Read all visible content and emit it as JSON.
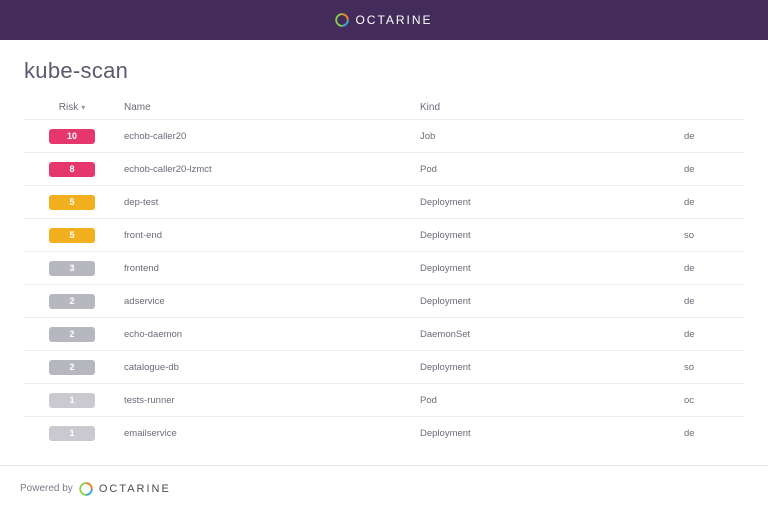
{
  "brand_name": "OCTARINE",
  "page_title": "kube-scan",
  "colors": {
    "risk_high": "#e6366e",
    "risk_med": "#f2b01e",
    "risk_low": "#b7b7c0",
    "risk_lowest": "#c9c9cf"
  },
  "columns": {
    "risk": "Risk",
    "name": "Name",
    "kind": "Kind",
    "namespace": ""
  },
  "rows": [
    {
      "risk": "10",
      "risk_level": "high",
      "name": "echob-caller20",
      "kind": "Job",
      "ns": "de"
    },
    {
      "risk": "8",
      "risk_level": "high",
      "name": "echob-caller20-lzmct",
      "kind": "Pod",
      "ns": "de"
    },
    {
      "risk": "5",
      "risk_level": "med",
      "name": "dep-test",
      "kind": "Deployment",
      "ns": "de"
    },
    {
      "risk": "5",
      "risk_level": "med",
      "name": "front-end",
      "kind": "Deployment",
      "ns": "so"
    },
    {
      "risk": "3",
      "risk_level": "low",
      "name": "frontend",
      "kind": "Deployment",
      "ns": "de"
    },
    {
      "risk": "2",
      "risk_level": "low",
      "name": "adservice",
      "kind": "Deployment",
      "ns": "de"
    },
    {
      "risk": "2",
      "risk_level": "low",
      "name": "echo-daemon",
      "kind": "DaemonSet",
      "ns": "de"
    },
    {
      "risk": "2",
      "risk_level": "low",
      "name": "catalogue-db",
      "kind": "Deployment",
      "ns": "so"
    },
    {
      "risk": "1",
      "risk_level": "lowest",
      "name": "tests-runner",
      "kind": "Pod",
      "ns": "oc"
    },
    {
      "risk": "1",
      "risk_level": "lowest",
      "name": "emailservice",
      "kind": "Deployment",
      "ns": "de"
    }
  ],
  "footer_prefix": "Powered by"
}
